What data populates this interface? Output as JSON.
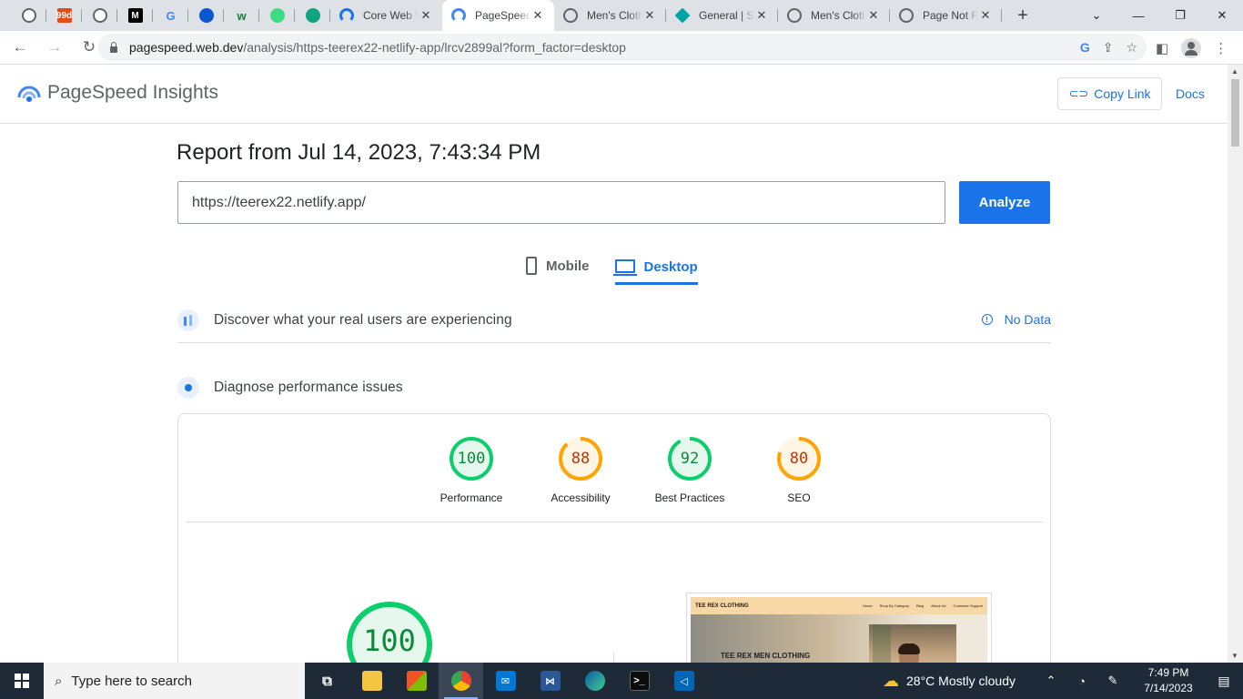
{
  "browser": {
    "pinned_tabs": [
      {
        "icon": "globe-icon",
        "color": "#5f6368"
      },
      {
        "icon": "99designs-icon",
        "color": "#e64a19",
        "text": "99d"
      },
      {
        "icon": "globe-icon",
        "color": "#5f6368"
      },
      {
        "icon": "medium-icon",
        "color": "#000000",
        "text": "M"
      },
      {
        "icon": "google-icon",
        "color": "#4285f4",
        "text": "G"
      },
      {
        "icon": "circle-icon",
        "color": "#0b57d0"
      },
      {
        "icon": "wix-icon",
        "color": "#1a7f37",
        "text": "w"
      },
      {
        "icon": "android-icon",
        "color": "#3ddc84"
      },
      {
        "icon": "openai-icon",
        "color": "#10a37f"
      }
    ],
    "tabs": [
      {
        "label": "Core Web Vitals",
        "icon": "core-web-vitals-icon",
        "color": "#1a73e8",
        "active": false
      },
      {
        "label": "PageSpeed Insights",
        "icon": "pagespeed-icon",
        "color": "#4285f4",
        "active": true
      },
      {
        "label": "Men's Clothing",
        "icon": "globe-icon",
        "color": "#5f6368",
        "active": false
      },
      {
        "label": "General | Slack",
        "icon": "diamond-icon",
        "color": "#00a3a3",
        "active": false
      },
      {
        "label": "Men's Clothing",
        "icon": "globe-icon",
        "color": "#5f6368",
        "active": false
      },
      {
        "label": "Page Not Found",
        "icon": "globe-icon",
        "color": "#5f6368",
        "active": false
      }
    ],
    "new_tab_symbol": "+",
    "url_host": "pagespeed.web.dev",
    "url_path": "/analysis/https-teerex22-netlify-app/lrcv2899al?form_factor=desktop"
  },
  "header": {
    "title": "PageSpeed Insights",
    "copy_link": "Copy Link",
    "docs": "Docs"
  },
  "report": {
    "title": "Report from Jul 14, 2023, 7:43:34 PM",
    "url_value": "https://teerex22.netlify.app/",
    "analyze": "Analyze",
    "tabs": {
      "mobile": "Mobile",
      "desktop": "Desktop"
    }
  },
  "sections": {
    "field_data": "Discover what your real users are experiencing",
    "no_data": "No Data",
    "diagnose": "Diagnose performance issues"
  },
  "scores": [
    {
      "label": "Performance",
      "value": "100",
      "fraction": 1.0,
      "color": "#0cce6b",
      "text_color": "#0c8a38",
      "fill": "#e6f8ee"
    },
    {
      "label": "Accessibility",
      "value": "88",
      "fraction": 0.88,
      "color": "#ffa400",
      "text_color": "#c33300",
      "fill": "#fff6e6"
    },
    {
      "label": "Best Practices",
      "value": "92",
      "fraction": 0.92,
      "color": "#0cce6b",
      "text_color": "#0c8a38",
      "fill": "#e6f8ee"
    },
    {
      "label": "SEO",
      "value": "80",
      "fraction": 0.8,
      "color": "#ffa400",
      "text_color": "#c33300",
      "fill": "#fff6e6"
    }
  ],
  "big_score": {
    "value": "100",
    "fraction": 1.0,
    "color": "#0cce6b"
  },
  "screenshot": {
    "brand": "TEE REX CLOTHING",
    "links": [
      "Home",
      "Shop By Category",
      "Blog",
      "About Us",
      "Customer Support"
    ],
    "hero_text": "TEE REX MEN CLOTHING"
  },
  "taskbar": {
    "search_placeholder": "Type here to search",
    "weather": "28°C  Mostly cloudy",
    "time": "7:49 PM",
    "date": "7/14/2023"
  }
}
